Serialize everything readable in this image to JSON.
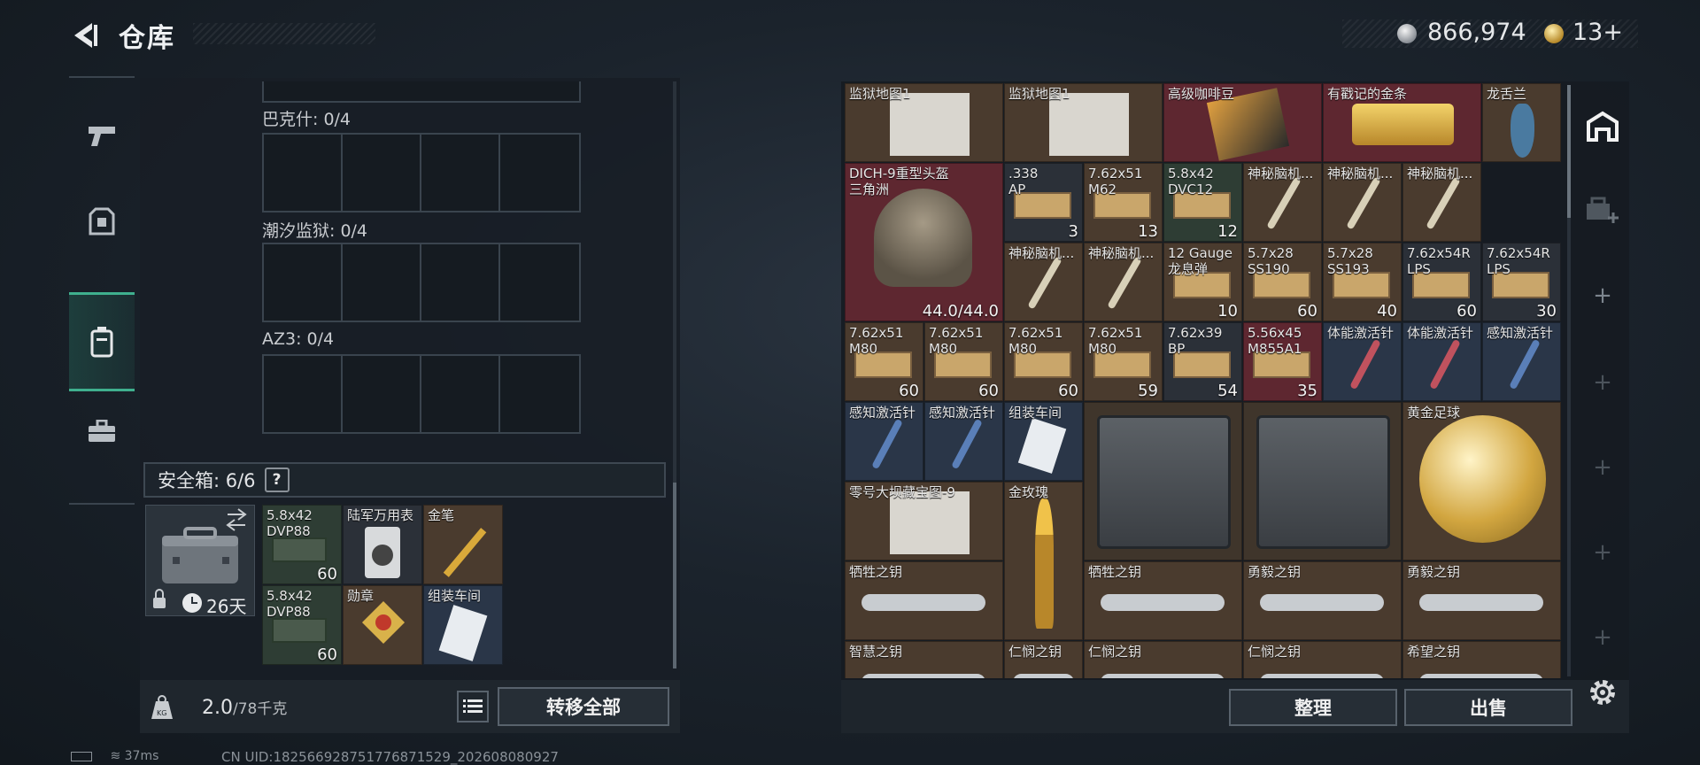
{
  "header": {
    "title": "仓库",
    "coins": "866,974",
    "gold": "13+"
  },
  "left_rail": {
    "tabs": [
      "weapons",
      "armor",
      "container",
      "briefcase"
    ]
  },
  "slots": [
    {
      "label": "巴克什: 0/4"
    },
    {
      "label": "潮汐监狱: 0/4"
    },
    {
      "label": "AZ3: 0/4"
    }
  ],
  "safebox": {
    "label": "安全箱: 6/6",
    "help": "?",
    "timer": "26天",
    "items": [
      {
        "name": "5.8x42\nDVP88",
        "qty": "60"
      },
      {
        "name": "陆军万用表",
        "qty": ""
      },
      {
        "name": "金笔",
        "qty": ""
      },
      {
        "name": "5.8x42\nDVP88",
        "qty": "60"
      },
      {
        "name": "勋章",
        "qty": ""
      },
      {
        "name": "组装车间",
        "qty": ""
      }
    ]
  },
  "weight": {
    "current": "2.0",
    "max": "/78千克",
    "transfer_label": "转移全部"
  },
  "stash": {
    "sort_label": "整理",
    "sell_label": "出售",
    "items": [
      {
        "name": "监狱地图1",
        "qty": ""
      },
      {
        "name": "监狱地图1",
        "qty": ""
      },
      {
        "name": "高级咖啡豆",
        "qty": ""
      },
      {
        "name": "有戳记的金条",
        "qty": ""
      },
      {
        "name": "龙舌兰",
        "qty": ""
      },
      {
        "name": "DICH-9重型头盔\n三角洲",
        "qty": "44.0/44.0"
      },
      {
        "name": ".338\nAP",
        "qty": "3"
      },
      {
        "name": "7.62x51\nM62",
        "qty": "13"
      },
      {
        "name": "5.8x42\nDVC12",
        "qty": "12"
      },
      {
        "name": "神秘脑机...",
        "qty": ""
      },
      {
        "name": "神秘脑机...",
        "qty": ""
      },
      {
        "name": "神秘脑机...",
        "qty": ""
      },
      {
        "name": "神秘脑机...",
        "qty": ""
      },
      {
        "name": "神秘脑机...",
        "qty": ""
      },
      {
        "name": "12 Gauge\n龙息弹",
        "qty": "10"
      },
      {
        "name": "5.7x28\nSS190",
        "qty": "60"
      },
      {
        "name": "5.7x28\nSS193",
        "qty": "40"
      },
      {
        "name": "7.62x54R\nLPS",
        "qty": "60"
      },
      {
        "name": "7.62x54R\nLPS",
        "qty": "30"
      },
      {
        "name": "7.62x51\nM80",
        "qty": "60"
      },
      {
        "name": "7.62x51\nM80",
        "qty": "60"
      },
      {
        "name": "7.62x51\nM80",
        "qty": "60"
      },
      {
        "name": "7.62x51\nM80",
        "qty": "59"
      },
      {
        "name": "7.62x39\nBP",
        "qty": "54"
      },
      {
        "name": "5.56x45\nM855A1",
        "qty": "35"
      },
      {
        "name": "体能激活针",
        "qty": ""
      },
      {
        "name": "体能激活针",
        "qty": ""
      },
      {
        "name": "感知激活针",
        "qty": ""
      },
      {
        "name": "感知激活针",
        "qty": ""
      },
      {
        "name": "感知激活针",
        "qty": ""
      },
      {
        "name": "组装车间",
        "qty": ""
      },
      {
        "name": "",
        "qty": ""
      },
      {
        "name": "",
        "qty": ""
      },
      {
        "name": "黄金足球",
        "qty": ""
      },
      {
        "name": "零号大坝藏宝图-9",
        "qty": ""
      },
      {
        "name": "金玫瑰",
        "qty": ""
      },
      {
        "name": "牺牲之钥",
        "qty": ""
      },
      {
        "name": "牺牲之钥",
        "qty": ""
      },
      {
        "name": "勇毅之钥",
        "qty": ""
      },
      {
        "name": "勇毅之钥",
        "qty": ""
      },
      {
        "name": "智慧之钥",
        "qty": ""
      },
      {
        "name": "仁悯之钥",
        "qty": ""
      },
      {
        "name": "仁悯之钥",
        "qty": ""
      },
      {
        "name": "仁悯之钥",
        "qty": ""
      },
      {
        "name": "希望之钥",
        "qty": ""
      }
    ]
  },
  "status": {
    "ping": "37ms",
    "uid": "CN UID:1825669287517768715​29_202608080927"
  },
  "colors": {
    "accent": "#3fb08e",
    "panel": "#1b222a"
  }
}
